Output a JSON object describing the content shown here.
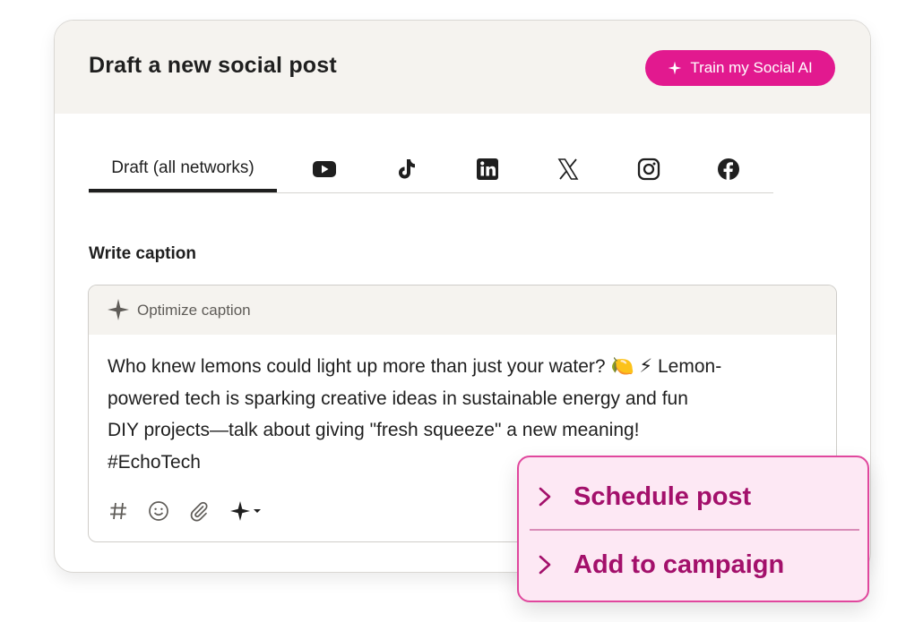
{
  "card": {
    "title": "Draft a new social post",
    "train_button_label": "Train my Social AI"
  },
  "tabs": [
    {
      "label": "Draft (all networks)",
      "active": true
    },
    {
      "icon": "youtube-icon"
    },
    {
      "icon": "tiktok-icon"
    },
    {
      "icon": "linkedin-icon"
    },
    {
      "icon": "x-icon"
    },
    {
      "icon": "instagram-icon"
    },
    {
      "icon": "facebook-icon"
    }
  ],
  "caption_section": {
    "label": "Write caption",
    "optimize_label": "Optimize caption",
    "lines": [
      "Who knew lemons could light up more than just your water? 🍋 ⚡ Lemon-",
      "powered tech is sparking creative ideas in sustainable energy and fun",
      "DIY projects—talk about giving \"fresh squeeze\" a new meaning!",
      "#EchoTech"
    ]
  },
  "toolbar_icons": [
    "hashtag-icon",
    "emoji-icon",
    "attachment-icon",
    "ai-sparkle-icon"
  ],
  "popup_menu": {
    "items": [
      "Schedule post",
      "Add to campaign"
    ]
  },
  "colors": {
    "accent": "#e2198f",
    "popup_text": "#a3106b",
    "popup_bg": "#fde8f4",
    "header_bg": "#f5f3ef"
  }
}
